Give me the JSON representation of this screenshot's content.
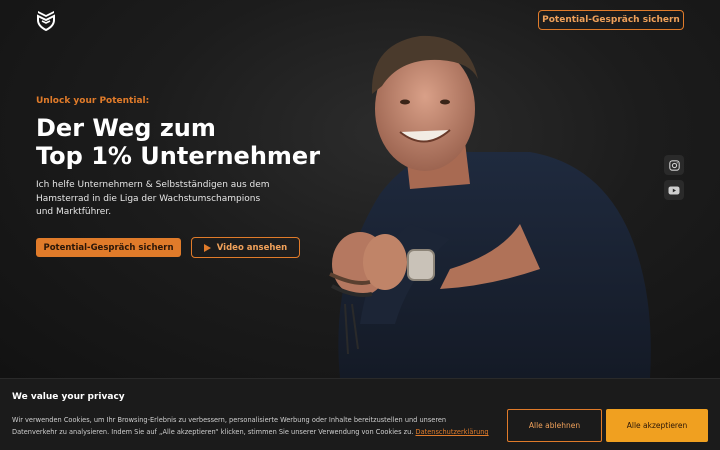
{
  "header": {
    "logo": "brand-shield-logo",
    "cta_label": "Potential-Gespräch sichern"
  },
  "hero": {
    "eyebrow": "Unlock your Potential:",
    "headline_line1": "Der Weg zum",
    "headline_line2": "Top 1% Unternehmer",
    "subtext": "Ich helfe Unternehmern & Selbstständigen aus dem Hamsterrad in die Liga der Wachstumschampions und Marktführer.",
    "primary_button": "Potential-Gespräch sichern",
    "video_button": "Video ansehen"
  },
  "social": {
    "items": [
      {
        "icon": "instagram-icon"
      },
      {
        "icon": "youtube-icon"
      }
    ]
  },
  "cookie_banner": {
    "title": "We value your privacy",
    "text": "Wir verwenden Cookies, um Ihr Browsing-Erlebnis zu verbessern, personalisierte Werbung oder Inhalte bereitzustellen und unseren Datenverkehr zu analysieren. Indem Sie auf „Alle akzeptieren“ klicken, stimmen Sie unserer Verwendung von Cookies zu.",
    "link": "Datenschutzerklärung",
    "reject_label": "Alle ablehnen",
    "accept_label": "Alle akzeptieren"
  },
  "colors": {
    "accent": "#e07b2a",
    "accent_bright": "#f0a020",
    "background": "#141414"
  }
}
